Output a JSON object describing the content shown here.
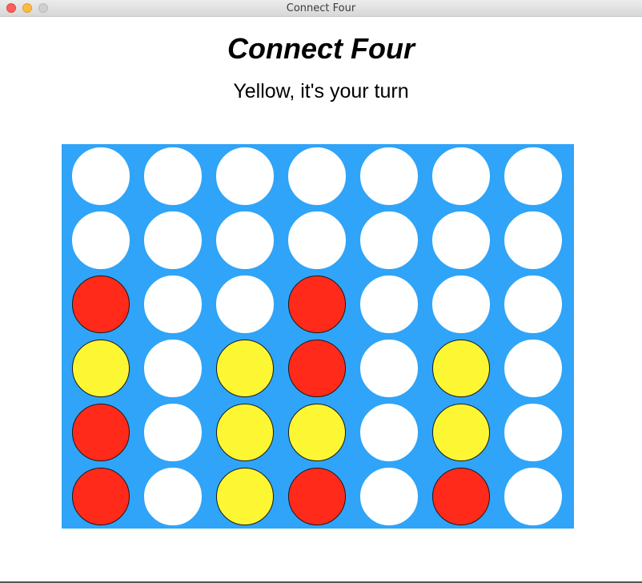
{
  "window": {
    "title": "Connect Four"
  },
  "game": {
    "title": "Connect Four",
    "status": "Yellow, it's your turn"
  },
  "colors": {
    "board": "#2fa4f8",
    "red": "#ff2a1a",
    "yellow": "#fdf733",
    "empty": "#ffffff"
  },
  "board": {
    "rows": [
      [
        "empty",
        "empty",
        "empty",
        "empty",
        "empty",
        "empty",
        "empty"
      ],
      [
        "empty",
        "empty",
        "empty",
        "empty",
        "empty",
        "empty",
        "empty"
      ],
      [
        "red",
        "empty",
        "empty",
        "red",
        "empty",
        "empty",
        "empty"
      ],
      [
        "yellow",
        "empty",
        "yellow",
        "red",
        "empty",
        "yellow",
        "empty"
      ],
      [
        "red",
        "empty",
        "yellow",
        "yellow",
        "empty",
        "yellow",
        "empty"
      ],
      [
        "red",
        "empty",
        "yellow",
        "red",
        "empty",
        "red",
        "empty"
      ]
    ]
  }
}
